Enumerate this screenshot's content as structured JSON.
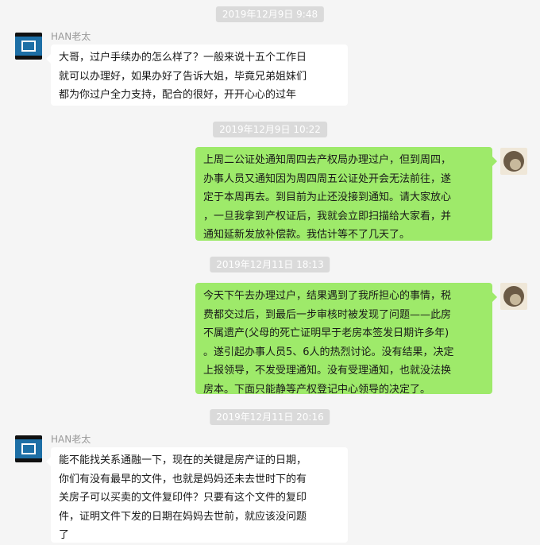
{
  "messages": [
    {
      "timestamp": "2019年12月9日 9:48",
      "sender": "HAN老太",
      "side": "left",
      "avatar_icon": "han-avatar-icon",
      "lines": [
        "大哥，过户手续办的怎么样了？一般来说十五个工作日",
        "就可以办理好，如果办好了告诉大姐，毕竟兄弟姐妹们",
        "都为你过户全力支持，配合的很好，开开心心的过年"
      ]
    },
    {
      "timestamp": "2019年12月9日 10:22",
      "side": "right",
      "avatar_icon": "self-avatar-icon",
      "lines": [
        "上周二公证处通知周四去产权局办理过户，但到周四，",
        "办事人员又通知因为周四周五公证处开会无法前往，遂",
        "定于本周再去。到目前为止还没接到通知。请大家放心",
        "，一旦我拿到产权证后，我就会立即扫描给大家看，并",
        "通知延新发放补偿款。我估计等不了几天了。"
      ]
    },
    {
      "timestamp": "2019年12月11日 18:13",
      "side": "right",
      "avatar_icon": "self-avatar-icon",
      "lines": [
        "今天下午去办理过户，结果遇到了我所担心的事情，税",
        "费都交过后，到最后一步审核时被发现了问题——此房",
        "不属遗产(父母的死亡证明早于老房本签发日期许多年)",
        "。遂引起办事人员5、6人的热烈讨论。没有结果，决定",
        "上报领导，不发受理通知。没有受理通知，也就没法换",
        "房本。下面只能静等产权登记中心领导的决定了。"
      ]
    },
    {
      "timestamp": "2019年12月11日 20:16",
      "sender": "HAN老太",
      "side": "left",
      "avatar_icon": "han-avatar-icon",
      "lines": [
        "能不能找关系通融一下，现在的关键是房产证的日期，",
        "你们有没有最早的文件，也就是妈妈还未去世时下的有",
        "关房子可以买卖的文件复印件？只要有这个文件的复印",
        "件，证明文件下发的日期在妈妈去世前，就应该没问题",
        "了"
      ]
    }
  ]
}
